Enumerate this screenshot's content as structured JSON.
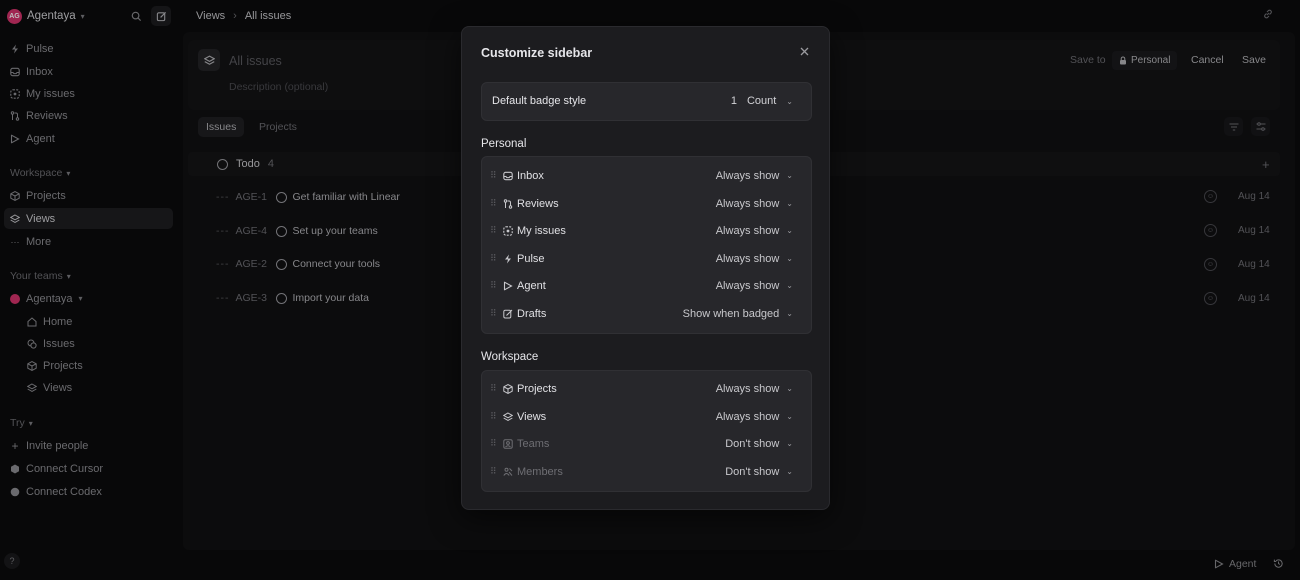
{
  "workspace": {
    "initials": "AG",
    "name": "Agentaya"
  },
  "sidebar": {
    "nav": [
      {
        "label": "Pulse",
        "icon": "pulse-icon"
      },
      {
        "label": "Inbox",
        "icon": "inbox-icon"
      },
      {
        "label": "My issues",
        "icon": "my-issues-icon"
      },
      {
        "label": "Reviews",
        "icon": "reviews-icon"
      },
      {
        "label": "Agent",
        "icon": "agent-icon"
      }
    ],
    "workspace_label": "Workspace",
    "workspace_items": [
      {
        "label": "Projects",
        "icon": "projects-icon"
      },
      {
        "label": "Views",
        "icon": "views-icon",
        "active": true
      },
      {
        "label": "More",
        "icon": "more-icon"
      }
    ],
    "teams_label": "Your teams",
    "team_name": "Agentaya",
    "team_items": [
      {
        "label": "Home",
        "icon": "home-icon"
      },
      {
        "label": "Issues",
        "icon": "issues-icon"
      },
      {
        "label": "Projects",
        "icon": "projects-icon"
      },
      {
        "label": "Views",
        "icon": "views-icon"
      }
    ],
    "try_label": "Try",
    "try_items": [
      {
        "label": "Invite people",
        "icon": "plus-icon"
      },
      {
        "label": "Connect Cursor",
        "icon": "cursor-icon"
      },
      {
        "label": "Connect Codex",
        "icon": "codex-icon"
      }
    ],
    "help": "?"
  },
  "breadcrumb": {
    "root": "Views",
    "sep": "›",
    "current": "All issues"
  },
  "view": {
    "title_placeholder": "All issues",
    "description_placeholder": "Description (optional)",
    "save_to": "Save to",
    "personal": "Personal",
    "cancel": "Cancel",
    "save": "Save",
    "tabs": [
      "Issues",
      "Projects"
    ]
  },
  "group": {
    "label": "Todo",
    "count": "4"
  },
  "issues": [
    {
      "id": "AGE-1",
      "title": "Get familiar with Linear",
      "date": "Aug 14"
    },
    {
      "id": "AGE-4",
      "title": "Set up your teams",
      "date": "Aug 14"
    },
    {
      "id": "AGE-2",
      "title": "Connect your tools",
      "date": "Aug 14"
    },
    {
      "id": "AGE-3",
      "title": "Import your data",
      "date": "Aug 14"
    }
  ],
  "bottom": {
    "agent": "Agent"
  },
  "modal": {
    "title": "Customize sidebar",
    "badge_label": "Default badge style",
    "badge_num": "1",
    "badge_value": "Count",
    "personal_label": "Personal",
    "personal_rows": [
      {
        "label": "Inbox",
        "option": "Always show",
        "icon": "inbox-icon"
      },
      {
        "label": "Reviews",
        "option": "Always show",
        "icon": "reviews-icon"
      },
      {
        "label": "My issues",
        "option": "Always show",
        "icon": "my-issues-icon"
      },
      {
        "label": "Pulse",
        "option": "Always show",
        "icon": "pulse-icon"
      },
      {
        "label": "Agent",
        "option": "Always show",
        "icon": "agent-icon"
      },
      {
        "label": "Drafts",
        "option": "Show when badged",
        "icon": "drafts-icon"
      }
    ],
    "workspace_label": "Workspace",
    "workspace_rows": [
      {
        "label": "Projects",
        "option": "Always show",
        "icon": "projects-icon"
      },
      {
        "label": "Views",
        "option": "Always show",
        "icon": "views-icon"
      },
      {
        "label": "Teams",
        "option": "Don't show",
        "icon": "teams-icon"
      },
      {
        "label": "Members",
        "option": "Don't show",
        "icon": "members-icon"
      }
    ]
  }
}
